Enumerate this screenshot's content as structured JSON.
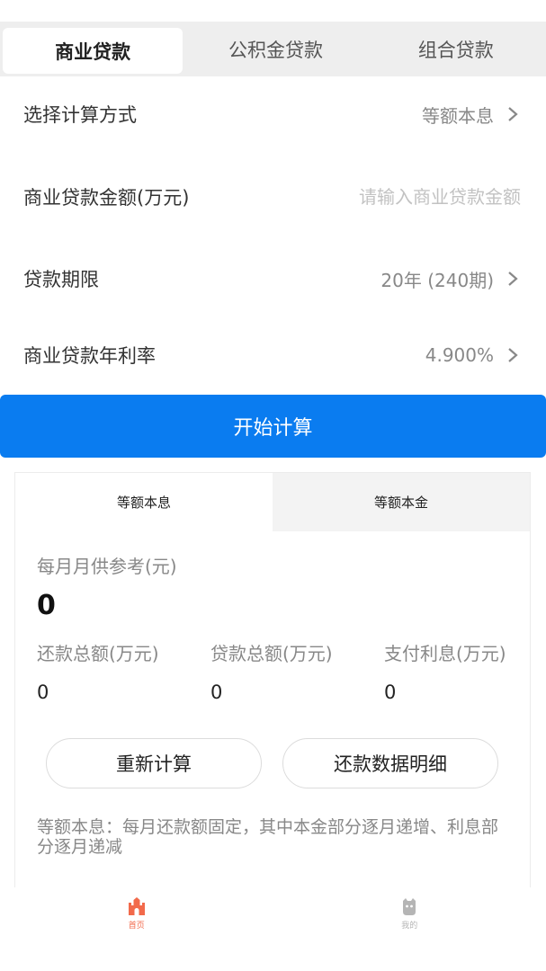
{
  "tabs": [
    {
      "label": "商业贷款",
      "active": true
    },
    {
      "label": "公积金贷款",
      "active": false
    },
    {
      "label": "组合贷款",
      "active": false
    }
  ],
  "form": {
    "method": {
      "label": "选择计算方式",
      "value": "等额本息"
    },
    "amount": {
      "label": "商业贷款金额(万元)",
      "value": "",
      "placeholder": "请输入商业贷款金额"
    },
    "term": {
      "label": "贷款期限",
      "value": "20年 (240期)"
    },
    "rate": {
      "label": "商业贷款年利率",
      "value": "4.900%"
    }
  },
  "calculate_button": "开始计算",
  "result": {
    "subtabs": [
      {
        "label": "等额本息",
        "active": true
      },
      {
        "label": "等额本金",
        "active": false
      }
    ],
    "monthly_label": "每月月供参考(元)",
    "monthly_value": "0",
    "stats": [
      {
        "label": "还款总额(万元)",
        "value": "0"
      },
      {
        "label": "贷款总额(万元)",
        "value": "0"
      },
      {
        "label": "支付利息(万元)",
        "value": "0"
      }
    ],
    "recalc_button": "重新计算",
    "detail_button": "还款数据明细",
    "note": "等额本息：每月还款额固定，其中本金部分逐月递增、利息部分逐月递减"
  },
  "bottom_nav": [
    {
      "label": "首页",
      "icon": "castle-icon",
      "active": true
    },
    {
      "label": "我的",
      "icon": "avatar-icon",
      "active": false
    }
  ],
  "colors": {
    "primary": "#0a7cf0",
    "nav_active": "#f26a4b",
    "nav_inactive": "#b5b5b5"
  }
}
